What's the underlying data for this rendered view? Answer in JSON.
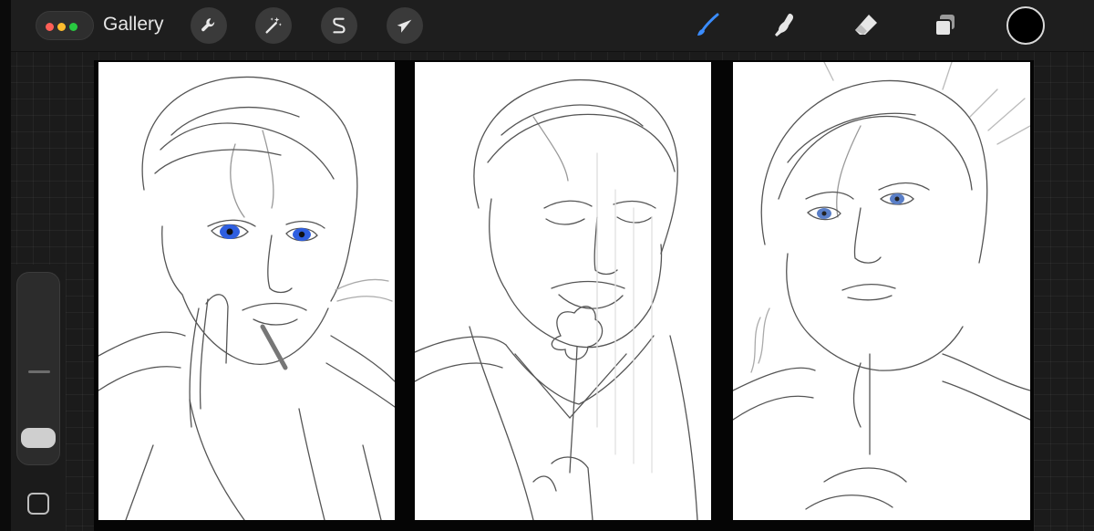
{
  "toolbar": {
    "gallery_label": "Gallery",
    "left_tools": [
      {
        "name": "actions",
        "icon": "wrench-icon"
      },
      {
        "name": "adjustments",
        "icon": "magic-wand-icon"
      },
      {
        "name": "selection",
        "icon": "selection-s-icon"
      },
      {
        "name": "transform",
        "icon": "arrow-cursor-icon"
      }
    ],
    "right_tools": [
      {
        "name": "brush",
        "icon": "brush-icon",
        "active": true
      },
      {
        "name": "smudge",
        "icon": "smudge-finger-icon",
        "active": false
      },
      {
        "name": "eraser",
        "icon": "eraser-icon",
        "active": false
      },
      {
        "name": "layers",
        "icon": "layers-icon",
        "active": false
      }
    ],
    "current_color": "#000000"
  },
  "window_controls": {
    "close": "#ff5f57",
    "minimize": "#febc2e",
    "maximize": "#28c840"
  },
  "sidebar": {
    "brush_size_icon": "slider-handle",
    "modify_button_icon": "square-icon"
  },
  "canvas": {
    "panels": [
      {
        "name": "panel-1",
        "eye_color": "#2f5fe0"
      },
      {
        "name": "panel-2",
        "eye_color": "none"
      },
      {
        "name": "panel-3",
        "eye_color": "#5a7fc8"
      }
    ],
    "accent": "#3a8cff"
  }
}
